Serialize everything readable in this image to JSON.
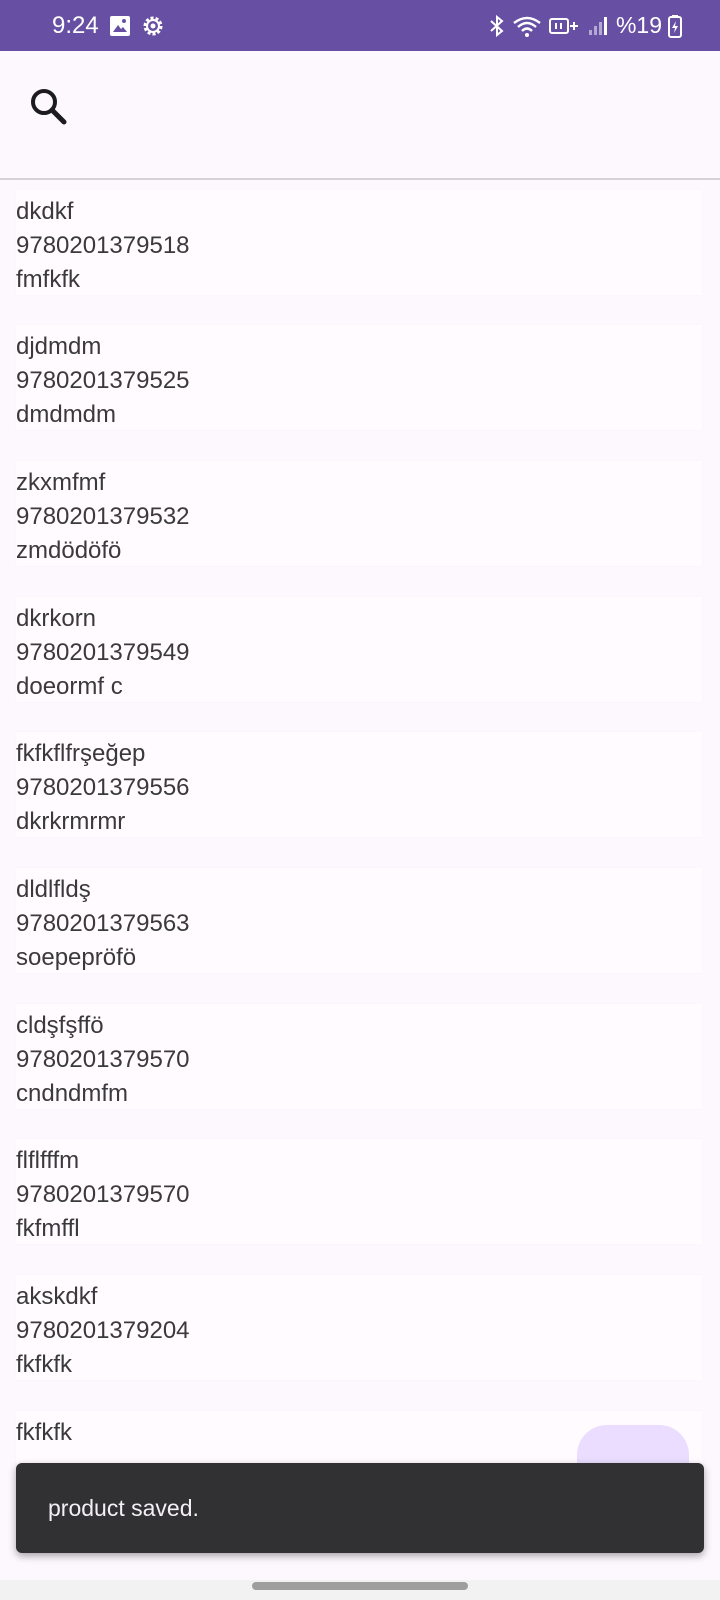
{
  "status_bar": {
    "time": "9:24",
    "battery_text": "%19",
    "icons": [
      "gallery-icon",
      "settings-gear-icon",
      "bluetooth-icon",
      "wifi-icon",
      "volte-icon",
      "signal-icon",
      "battery-charging-icon"
    ]
  },
  "top_bar": {
    "search_icon": "search-icon"
  },
  "products": [
    {
      "name": "dkdkf",
      "barcode": "9780201379518",
      "description": "fmfkfk"
    },
    {
      "name": "djdmdm",
      "barcode": "9780201379525",
      "description": "dmdmdm"
    },
    {
      "name": "zkxmfmf",
      "barcode": "9780201379532",
      "description": "zmdödöfö"
    },
    {
      "name": "dkrkorn",
      "barcode": "9780201379549",
      "description": "doeormf c"
    },
    {
      "name": "fkfkflfrşeğep",
      "barcode": "9780201379556",
      "description": "dkrkrmrmr"
    },
    {
      "name": "dldlfldş",
      "barcode": "9780201379563",
      "description": "soepepröfö"
    },
    {
      "name": "cldşfşffö",
      "barcode": "9780201379570",
      "description": "cndndmfm"
    },
    {
      "name": "flflfffm",
      "barcode": "9780201379570",
      "description": "fkfmffl"
    },
    {
      "name": "akskdkf",
      "barcode": "9780201379204",
      "description": "fkfkfk"
    },
    {
      "name": "fkfkfk"
    }
  ],
  "fab": {
    "icon": "add-icon"
  },
  "snackbar": {
    "message": "product saved."
  },
  "colors": {
    "status_bar": "#6750a4",
    "background": "#fdf8fd",
    "card": "#fffbff",
    "fab": "#eaddff",
    "snackbar": "#313033"
  }
}
